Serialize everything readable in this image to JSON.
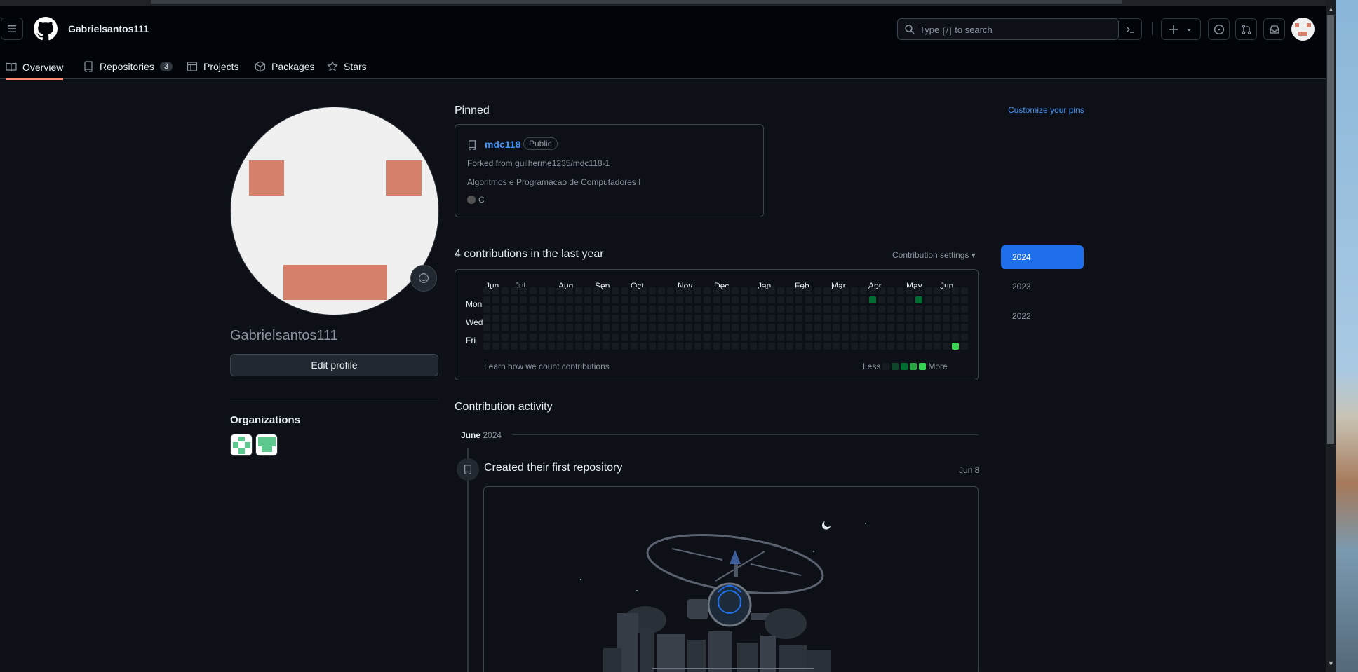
{
  "header": {
    "username": "Gabrielsantos111",
    "search_prefix": "Type",
    "search_key": "/",
    "search_suffix": "to search"
  },
  "nav": {
    "tabs": [
      {
        "label": "Overview",
        "icon": "book-icon",
        "active": true
      },
      {
        "label": "Repositories",
        "icon": "repo-icon",
        "count": "3"
      },
      {
        "label": "Projects",
        "icon": "table-icon"
      },
      {
        "label": "Packages",
        "icon": "package-icon"
      },
      {
        "label": "Stars",
        "icon": "star-icon"
      }
    ]
  },
  "profile": {
    "name": "Gabrielsantos111",
    "edit_label": "Edit profile",
    "organizations_title": "Organizations"
  },
  "pinned": {
    "title": "Pinned",
    "customize": "Customize your pins",
    "repo": {
      "name": "mdc118",
      "visibility": "Public",
      "forked_prefix": "Forked from",
      "forked_from": "guilherme1235/mdc118-1",
      "description": "Algoritmos e Programacao de Computadores I",
      "language": "C",
      "language_color": "#555555"
    }
  },
  "contributions": {
    "title": "4 contributions in the last year",
    "settings": "Contribution settings",
    "months": [
      "Jun",
      "Jul",
      "Aug",
      "Sep",
      "Oct",
      "Nov",
      "Dec",
      "Jan",
      "Feb",
      "Mar",
      "Apr",
      "May",
      "Jun"
    ],
    "days": [
      "Mon",
      "Wed",
      "Fri"
    ],
    "learn": "Learn how we count contributions",
    "less": "Less",
    "more": "More",
    "active_cells": [
      {
        "week": 42,
        "day": 1,
        "level": 2
      },
      {
        "week": 47,
        "day": 1,
        "level": 2
      },
      {
        "week": 51,
        "day": 6,
        "level": 4
      }
    ]
  },
  "years": [
    "2024",
    "2023",
    "2022"
  ],
  "activity": {
    "title": "Contribution activity",
    "month": "June",
    "year": "2024",
    "event": "Created their first repository",
    "date": "Jun 8"
  },
  "colors": {
    "accent": "#1f6feb",
    "link": "#4493f8",
    "tab_underline": "#fd8c73",
    "avatar_pixel": "#d5806a",
    "green": [
      "#161b22",
      "#0e4429",
      "#006d32",
      "#26a641",
      "#39d353"
    ]
  }
}
